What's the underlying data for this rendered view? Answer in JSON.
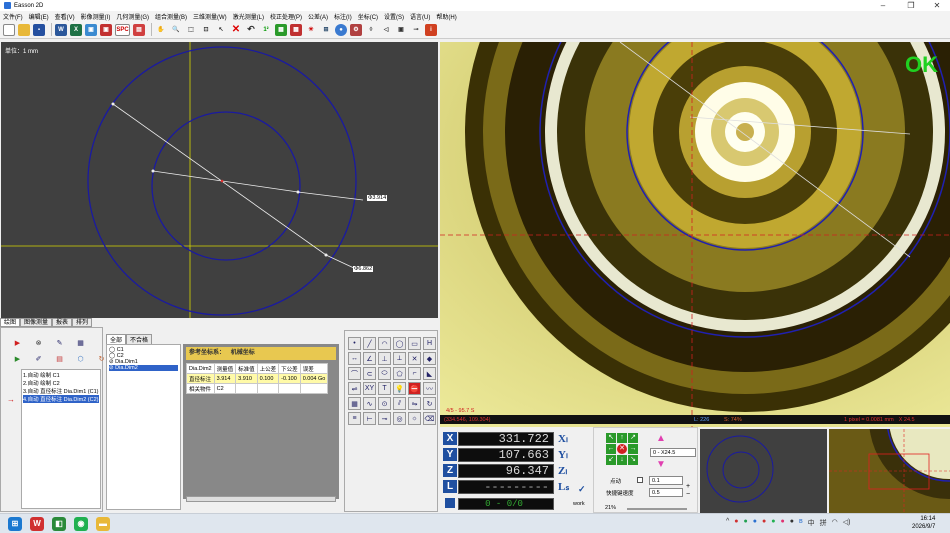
{
  "app": {
    "title": "Easson 2D",
    "min_icon": "minimize-icon",
    "max_icon": "maximize-icon",
    "close_icon": "close-icon"
  },
  "menu": [
    "文件(F)",
    "编辑(E)",
    "查看(V)",
    "影像测量(I)",
    "几何测量(G)",
    "组合测量(B)",
    "三维测量(W)",
    "激光测量(L)",
    "校正处理(P)",
    "公差(A)",
    "标注(I)",
    "坐标(C)",
    "设置(S)",
    "语言(U)",
    "帮助(H)"
  ],
  "toolbar": {
    "spc_label": "SPC",
    "undo_icon": "undo-icon",
    "cut_icon": "x-icon",
    "save_icon": "save-icon"
  },
  "cad": {
    "scale_label": "单位：1 mm",
    "dim_inner": "Φ3.914",
    "dim_outer": "Φ6.862"
  },
  "camera": {
    "ok_label": "OK",
    "status_mag": "4/5 - 95.7 S",
    "status_coord": "(334.546, 109.304)",
    "status_l": "L: 226",
    "status_s": "S: 74%",
    "status_pixel": "1 pixel = 0.0081 mm",
    "status_zoom": "X 24.5"
  },
  "bottom_tabs": [
    "绘图",
    "图像测量",
    "报表",
    "排列"
  ],
  "feature_list": [
    "1.自动 绘制 C1",
    "2.自动 绘制 C2",
    "3.自动 直径标注 Dia.Dim1 (C1)",
    "4.自动 直径标注 Dia.Dim2 (C2)"
  ],
  "elem_tabs": [
    "全部",
    "不合格"
  ],
  "elem_list": [
    "C1",
    "C2",
    "Dia.Dim1",
    "Dia.Dim2"
  ],
  "result": {
    "coord_label": "参考坐标系：",
    "coord_value": "机械坐标",
    "headers": [
      "Dia.Dim2",
      "测量值",
      "标准值",
      "上公差",
      "下公差",
      "误差"
    ],
    "row1": [
      "直径标注",
      "3.914",
      "3.910",
      "0.100",
      "-0.100",
      "0.004",
      "Go"
    ],
    "row2": [
      "相关物件",
      "C2"
    ]
  },
  "dro": {
    "x_label": "X",
    "y_label": "Y",
    "z_label": "Z",
    "l_label": "L",
    "x_value": "331.722",
    "y_value": "107.663",
    "z_value": "96.347",
    "l_value": "---------",
    "x_unit": "Xₗ",
    "y_unit": "Yₗ",
    "z_unit": "Zₗ",
    "l_unit": "Lₛ",
    "counter": "0 - 0/0",
    "work_label": "work"
  },
  "motion": {
    "lens_select": "0 - X24.5",
    "step_label": "点动",
    "step_value": "0.1",
    "speed_label": "快捷键速度",
    "speed_value": "0.5",
    "light_pct": "21%"
  },
  "taskbar": {
    "time": "16:14",
    "date": "2026/9/7",
    "ime1": "中",
    "ime2": "拼"
  }
}
